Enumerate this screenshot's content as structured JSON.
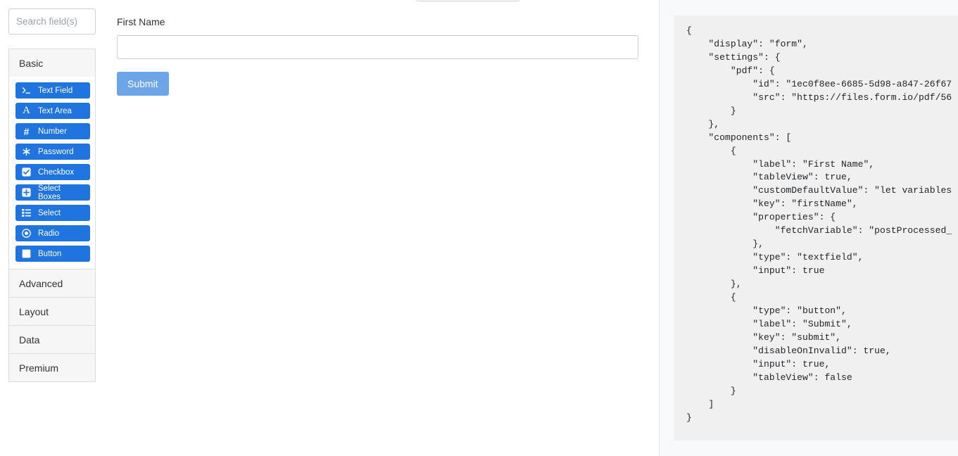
{
  "palette": {
    "search": {
      "placeholder": "Search field(s)",
      "value": ""
    },
    "groups": [
      {
        "name": "basic",
        "label": "Basic",
        "expanded": true,
        "components": [
          {
            "label": "Text Field",
            "icon": "terminal-prompt-icon"
          },
          {
            "label": "Text Area",
            "icon": "letter-a-icon"
          },
          {
            "label": "Number",
            "icon": "hash-icon"
          },
          {
            "label": "Password",
            "icon": "asterisk-icon"
          },
          {
            "label": "Checkbox",
            "icon": "checkbox-checked-icon"
          },
          {
            "label": "Select Boxes",
            "icon": "plus-square-icon"
          },
          {
            "label": "Select",
            "icon": "list-icon"
          },
          {
            "label": "Radio",
            "icon": "radio-dot-icon"
          },
          {
            "label": "Button",
            "icon": "square-icon"
          }
        ]
      },
      {
        "name": "advanced",
        "label": "Advanced",
        "expanded": false,
        "components": []
      },
      {
        "name": "layout",
        "label": "Layout",
        "expanded": false,
        "components": []
      },
      {
        "name": "data",
        "label": "Data",
        "expanded": false,
        "components": []
      },
      {
        "name": "premium",
        "label": "Premium",
        "expanded": false,
        "components": []
      }
    ],
    "accent_color": "#1f74e0"
  },
  "form_preview": {
    "first_name": {
      "label": "First Name",
      "value": "",
      "placeholder": ""
    },
    "submit": {
      "label": "Submit",
      "color": "#6ca6e8",
      "disabled": true
    }
  },
  "json_panel": {
    "schema_text": "{\n    \"display\": \"form\",\n    \"settings\": {\n        \"pdf\": {\n            \"id\": \"1ec0f8ee-6685-5d98-a847-26f67\n            \"src\": \"https://files.form.io/pdf/56\n        }\n    },\n    \"components\": [\n        {\n            \"label\": \"First Name\",\n            \"tableView\": true,\n            \"customDefaultValue\": \"let variables\n            \"key\": \"firstName\",\n            \"properties\": {\n                \"fetchVariable\": \"postProcessed_\n            },\n            \"type\": \"textfield\",\n            \"input\": true\n        },\n        {\n            \"type\": \"button\",\n            \"label\": \"Submit\",\n            \"key\": \"submit\",\n            \"disableOnInvalid\": true,\n            \"input\": true,\n            \"tableView\": false\n        }\n    ]\n}"
  }
}
